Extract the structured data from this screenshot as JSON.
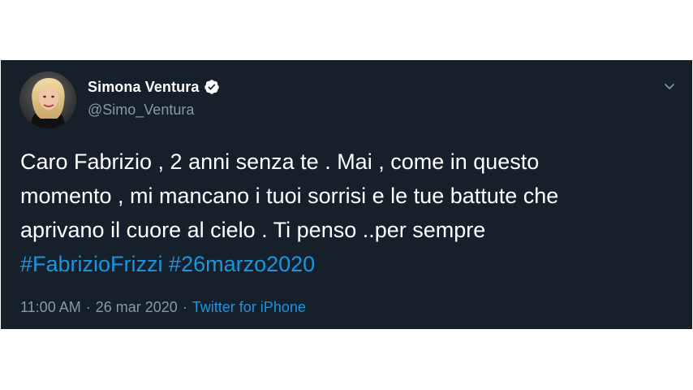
{
  "colors": {
    "card_background": "#15202b",
    "text_primary": "#ffffff",
    "text_secondary": "#8899a6",
    "accent": "#1b95e0",
    "page_background": "#ffffff"
  },
  "user": {
    "display_name": "Simona Ventura",
    "handle": "@Simo_Ventura",
    "verified": true,
    "verified_icon": "verified-badge-icon",
    "avatar_icon": "profile-photo"
  },
  "tweet": {
    "lines": [
      "Caro Fabrizio , 2 anni senza te . Mai , come in questo",
      "momento , mi mancano i tuoi sorrisi e le tue battute che",
      "aprivano il cuore al cielo . Ti penso ..per sempre"
    ],
    "hashtags": [
      "#FabrizioFrizzi",
      "#26marzo2020"
    ]
  },
  "meta": {
    "time": "11:00 AM",
    "separator": "·",
    "date": "26 mar 2020",
    "source": "Twitter for iPhone"
  },
  "menu": {
    "icon": "chevron-down-icon"
  }
}
